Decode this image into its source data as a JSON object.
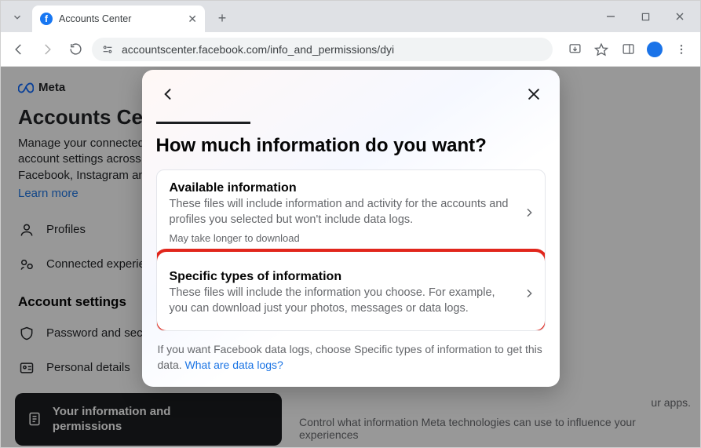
{
  "browser": {
    "tab_title": "Accounts Center",
    "url": "accountscenter.facebook.com/info_and_permissions/dyi"
  },
  "page": {
    "brand": "Meta",
    "title": "Accounts Center",
    "description": "Manage your connected experiences and account settings across Meta technologies like Facebook, Instagram and more.",
    "learn_more": "Learn more",
    "nav": {
      "profiles": "Profiles",
      "connected": "Connected experiences"
    },
    "section_heading": "Account settings",
    "settings": {
      "password": "Password and security",
      "personal": "Personal details"
    },
    "active_item": "Your information and permissions",
    "right_apps_fragment": "ur apps.",
    "right_note": "Control what information Meta technologies can use to influence your experiences"
  },
  "modal": {
    "title": "How much information do you want?",
    "options": [
      {
        "title": "Available information",
        "desc": "These files will include information and activity for the accounts and profiles you selected but won't include data logs.",
        "note": "May take longer to download"
      },
      {
        "title": "Specific types of information",
        "desc": "These files will include the information you choose. For example, you can download just your photos, messages or data logs."
      }
    ],
    "footer_text": "If you want Facebook data logs, choose Specific types of information to get this data. ",
    "footer_link": "What are data logs?"
  }
}
